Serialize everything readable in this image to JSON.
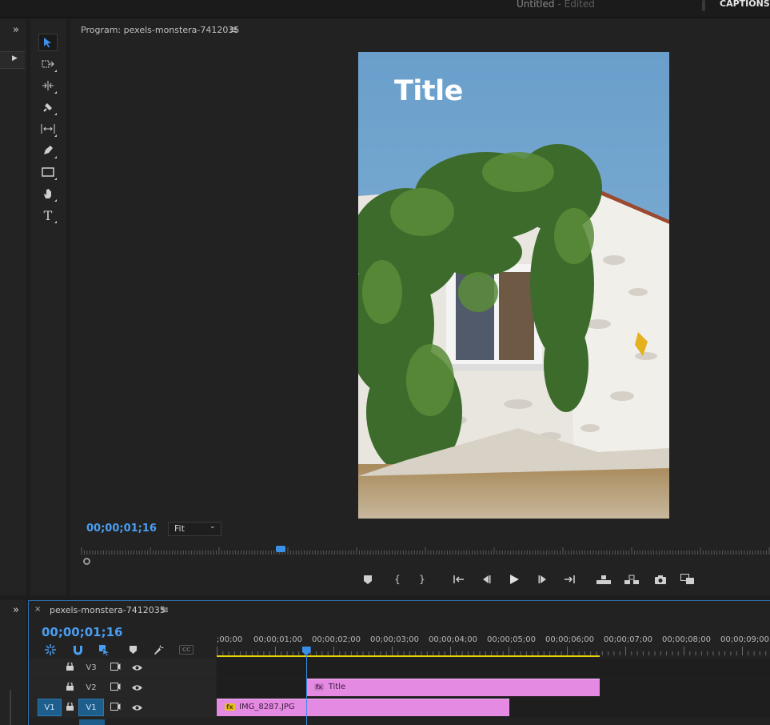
{
  "header": {
    "doc_title": "Untitled",
    "doc_status": "- Edited",
    "workspace_label": "CAPTIONS A"
  },
  "panels": {
    "expand_glyph": "»"
  },
  "tools": [
    {
      "name": "selection-tool",
      "icon": "arrow-icon",
      "active": true
    },
    {
      "name": "track-select-tool",
      "icon": "track-select-icon"
    },
    {
      "name": "ripple-edit-tool",
      "icon": "ripple-edit-icon"
    },
    {
      "name": "razor-tool",
      "icon": "razor-icon"
    },
    {
      "name": "slip-tool",
      "icon": "slip-icon"
    },
    {
      "name": "pen-tool",
      "icon": "pen-icon"
    },
    {
      "name": "rectangle-tool",
      "icon": "rectangle-icon"
    },
    {
      "name": "hand-tool",
      "icon": "hand-icon"
    },
    {
      "name": "type-tool",
      "icon": "type-icon",
      "glyph": "T"
    }
  ],
  "program": {
    "label": "Program: pexels-monstera-7412035",
    "menu_glyph": "≡",
    "overlay_title": "Title",
    "timecode": "00;00;01;16",
    "zoom": "Fit",
    "playhead_fraction": 0.29
  },
  "transport": [
    {
      "name": "add-marker-button",
      "glyph": "⬟"
    },
    {
      "name": "mark-in-button",
      "glyph": "{"
    },
    {
      "name": "mark-out-button",
      "glyph": "}"
    },
    {
      "name": "go-to-in-button",
      "glyph": "⇤"
    },
    {
      "name": "step-back-button",
      "glyph": "◀|"
    },
    {
      "name": "play-button",
      "glyph": "▶"
    },
    {
      "name": "step-forward-button",
      "glyph": "|▶"
    },
    {
      "name": "go-to-out-button",
      "glyph": "⇥"
    },
    {
      "name": "lift-button",
      "glyph": "⏏"
    },
    {
      "name": "extract-button",
      "glyph": "⏏"
    },
    {
      "name": "export-frame-button",
      "glyph": "📷"
    },
    {
      "name": "comparison-view-button",
      "glyph": "⧉"
    }
  ],
  "timeline": {
    "close_glyph": "×",
    "sequence_name": "pexels-monstera-7412035",
    "menu_glyph": "≡",
    "timecode": "00;00;01;16",
    "cc_label": "CC",
    "ruler_labels": [
      ";00;00",
      "00;00;01;00",
      "00;00;02;00",
      "00;00;03;00",
      "00;00;04;00",
      "00;00;05;00",
      "00;00;06;00",
      "00;00;07;00",
      "00;00;08;00",
      "00;00;09;00"
    ],
    "tracks": [
      {
        "name": "V3",
        "source": "",
        "clips": []
      },
      {
        "name": "V2",
        "source": "",
        "clips": [
          {
            "label": "Title",
            "fx": "fx",
            "start_s": 1.53,
            "end_s": 6.56
          }
        ]
      },
      {
        "name": "V1",
        "source": "V1",
        "clips": [
          {
            "label": "IMG_8287.JPG",
            "fx": "fx",
            "start_s": 0.0,
            "end_s": 5.01
          }
        ]
      }
    ],
    "work_area_end_s": 6.56,
    "playhead_s": 1.53
  },
  "colors": {
    "accent": "#4a9ef2",
    "clip": "#e58ae3",
    "work_area": "#e8d400"
  }
}
